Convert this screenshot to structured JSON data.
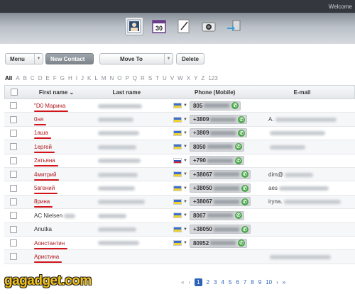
{
  "header": {
    "welcome": "Welcome",
    "apps": [
      {
        "icon": "contacts-icon",
        "active": true
      },
      {
        "icon": "calendar-icon",
        "label": "30",
        "active": false
      },
      {
        "icon": "notes-icon",
        "active": false
      },
      {
        "icon": "camera-icon",
        "active": false
      },
      {
        "icon": "sync-icon",
        "active": false
      }
    ]
  },
  "toolbar": {
    "menu_label": "Menu",
    "new_contact_label": "New Contact",
    "move_to_label": "Move To",
    "delete_label": "Delete"
  },
  "alphabet": [
    "All",
    "A",
    "B",
    "C",
    "D",
    "E",
    "F",
    "G",
    "H",
    "I",
    "J",
    "K",
    "L",
    "M",
    "N",
    "O",
    "P",
    "Q",
    "R",
    "S",
    "T",
    "U",
    "V",
    "W",
    "X",
    "Y",
    "Z",
    "123"
  ],
  "table": {
    "columns": {
      "first_name": "First name ⌄",
      "last_name": "Last name",
      "phone": "Phone (Mobile)",
      "email": "E-mail"
    },
    "rows": [
      {
        "first": "\"D0 Марина",
        "underline": true,
        "phone": "805",
        "flag": "ua",
        "email": ""
      },
      {
        "first": "0ня",
        "underline": true,
        "phone": "+3809",
        "flag": "ua",
        "email": "A."
      },
      {
        "first": "1аша",
        "underline": true,
        "phone": "+3809",
        "flag": "ua",
        "email": ""
      },
      {
        "first": "1ергей",
        "underline": true,
        "phone": "8050",
        "flag": "ua",
        "email": ""
      },
      {
        "first": "2атьяна",
        "underline": true,
        "phone": "+790",
        "flag": "ru",
        "email": ""
      },
      {
        "first": "4митрий",
        "underline": true,
        "phone": "+38067",
        "flag": "ua",
        "email": "dim@"
      },
      {
        "first": "5вгений",
        "underline": true,
        "phone": "+38050",
        "flag": "ua",
        "email": "aes"
      },
      {
        "first": "8рина",
        "underline": true,
        "phone": "+38067",
        "flag": "ua",
        "email": "iryna."
      },
      {
        "first": "AC Nielsen",
        "underline": false,
        "phone": "8067",
        "flag": "ua",
        "email": ""
      },
      {
        "first": "Anutka",
        "underline": false,
        "phone": "+38050",
        "flag": "ua",
        "email": ""
      },
      {
        "first": "Aонстантин",
        "underline": true,
        "phone": "80952",
        "flag": "ua",
        "email": ""
      },
      {
        "first": "Аристина",
        "underline": true,
        "phone": "",
        "flag": "",
        "email": ""
      }
    ]
  },
  "pager": {
    "first": "«",
    "prev": "‹",
    "pages": [
      "1",
      "2",
      "3",
      "4",
      "5",
      "6",
      "7",
      "8",
      "9",
      "10"
    ],
    "current": "1",
    "next": "›",
    "last": "»"
  },
  "watermark": "gagadget.com"
}
